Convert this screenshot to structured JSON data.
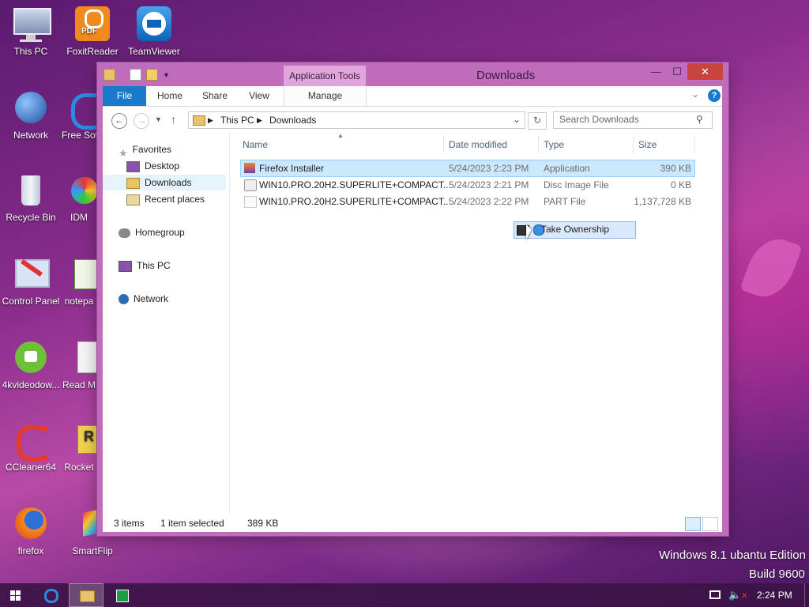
{
  "desktop": {
    "icons": [
      {
        "label": "This PC"
      },
      {
        "label": "FoxitReader"
      },
      {
        "label": "TeamViewer"
      },
      {
        "label": "Network"
      },
      {
        "label": "Free Sof"
      },
      {
        "label": "Recycle Bin"
      },
      {
        "label": "IDM"
      },
      {
        "label": "Control Panel"
      },
      {
        "label": "notepa"
      },
      {
        "label": "4kvideodow..."
      },
      {
        "label": "Read M"
      },
      {
        "label": "CCleaner64"
      },
      {
        "label": "Rocket"
      },
      {
        "label": "firefox"
      },
      {
        "label": "SmartFlip"
      }
    ],
    "edition_text": "Windows 8.1 ubantu Edition",
    "build_text": "Build 9600"
  },
  "window": {
    "title": "Downloads",
    "contextual_tab": "Application Tools",
    "ribbon_tabs": [
      "File",
      "Home",
      "Share",
      "View",
      "Manage"
    ],
    "breadcrumb": [
      "This PC",
      "Downloads"
    ],
    "search_placeholder": "Search Downloads",
    "nav": {
      "favorites": "Favorites",
      "desktop": "Desktop",
      "downloads": "Downloads",
      "recent": "Recent places",
      "homegroup": "Homegroup",
      "thispc": "This PC",
      "network": "Network"
    },
    "columns": [
      "Name",
      "Date modified",
      "Type",
      "Size"
    ],
    "files": [
      {
        "name": "Firefox Installer",
        "date": "5/24/2023 2:23 PM",
        "type": "Application",
        "size": "390 KB"
      },
      {
        "name": "WIN10.PRO.20H2.SUPERLITE+COMPACT...",
        "date": "5/24/2023 2:21 PM",
        "type": "Disc Image File",
        "size": "0 KB"
      },
      {
        "name": "WIN10.PRO.20H2.SUPERLITE+COMPACT...",
        "date": "5/24/2023 2:22 PM",
        "type": "PART File",
        "size": "1,137,728 KB"
      }
    ],
    "context_item": "Take Ownership",
    "status": {
      "items": "3 items",
      "selected": "1 item selected",
      "size": "389 KB"
    }
  },
  "taskbar": {
    "time": "2:24 PM"
  },
  "colors": {
    "accent": "#1979ca",
    "window_frame": "#c06cbd",
    "selection": "#cce8ff"
  }
}
